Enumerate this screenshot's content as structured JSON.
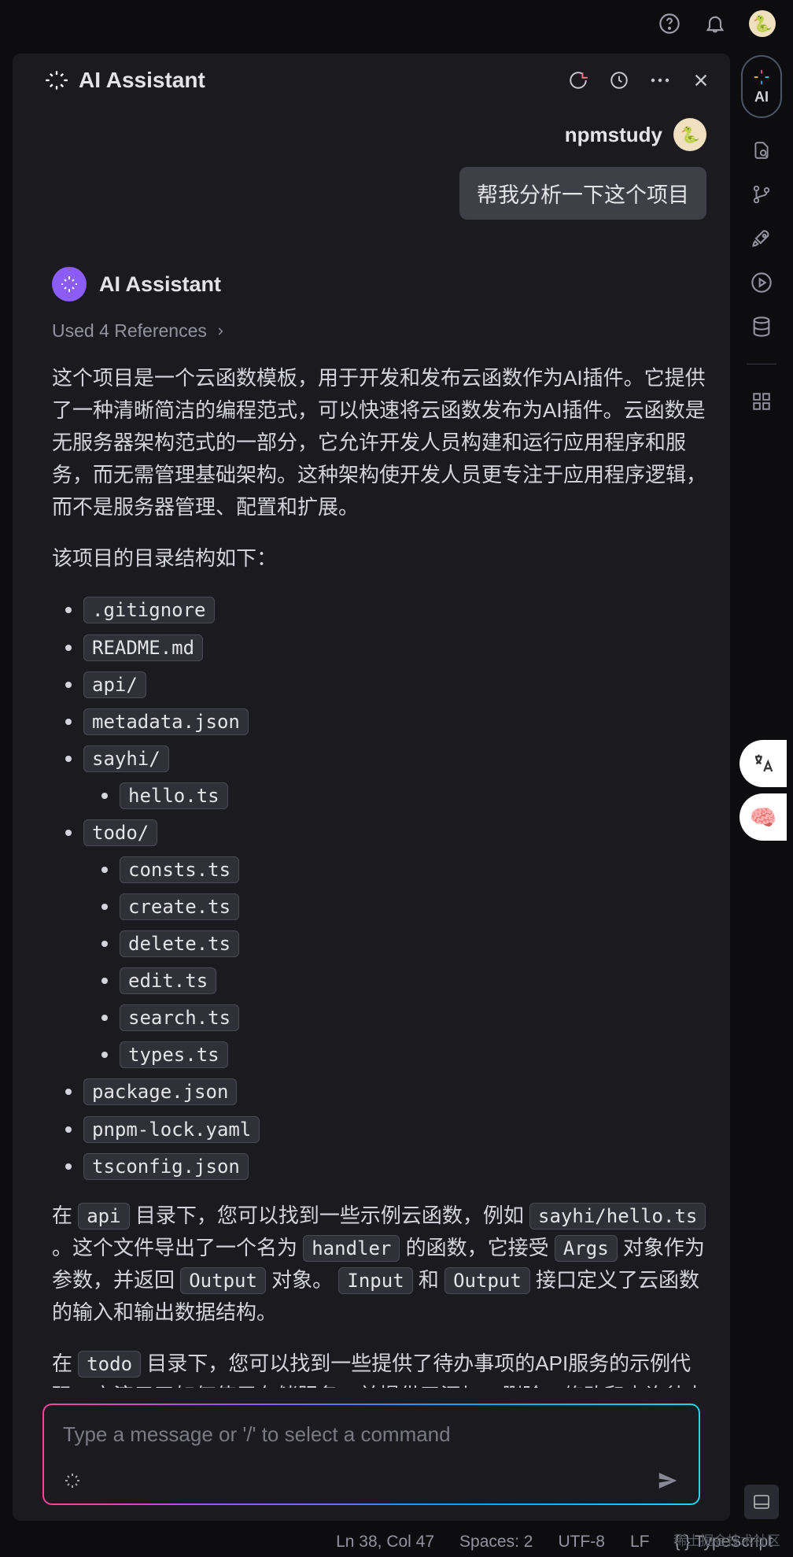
{
  "header": {
    "title": "AI Assistant"
  },
  "user_message": {
    "name": "npmstudy",
    "text": "帮我分析一下这个项目"
  },
  "assistant": {
    "name": "AI Assistant",
    "references": "Used 4 References",
    "para1": "这个项目是一个云函数模板，用于开发和发布云函数作为AI插件。它提供了一种清晰简洁的编程范式，可以快速将云函数发布为AI插件。云函数是无服务器架构范式的一部分，它允许开发人员构建和运行应用程序和服务，而无需管理基础架构。这种架构使开发人员更专注于应用程序逻辑，而不是服务器管理、配置和扩展。",
    "para2": "该项目的目录结构如下：",
    "files": [
      ".gitignore",
      "README.md",
      "api/",
      "metadata.json",
      "sayhi/",
      "todo/",
      "package.json",
      "pnpm-lock.yaml",
      "tsconfig.json"
    ],
    "sayhi_children": [
      "hello.ts"
    ],
    "todo_children": [
      "consts.ts",
      "create.ts",
      "delete.ts",
      "edit.ts",
      "search.ts",
      "types.ts"
    ],
    "para3_pre": "在 ",
    "para3_c1": "api",
    "para3_m1": " 目录下，您可以找到一些示例云函数，例如 ",
    "para3_c2": "sayhi/hello.ts",
    "para3_m2": " 。这个文件导出了一个名为 ",
    "para3_c3": "handler",
    "para3_m3": " 的函数，它接受 ",
    "para3_c4": "Args",
    "para3_m4": " 对象作为参数，并返回 ",
    "para3_c5": "Output",
    "para3_m5": " 对象。 ",
    "para3_c6": "Input",
    "para3_m6": " 和 ",
    "para3_c7": "Output",
    "para3_m7": " 接口定义了云函数的输入和输出数据结构。",
    "para4_pre": "在 ",
    "para4_c1": "todo",
    "para4_m1": " 目录下，您可以找到一些提供了待办事项的API服务的示例代码。它演示了如何使用存储服务，并提供了添加、删除、修改和查询待办事项的API功能。"
  },
  "input": {
    "placeholder": "Type a message or '/' to select a command"
  },
  "ai_badge": "AI",
  "status": {
    "position": "Ln 38, Col 47",
    "spaces": "Spaces: 2",
    "encoding": "UTF-8",
    "eol": "LF",
    "lang": "TypeScript"
  },
  "watermark": "稀土掘金技术社区"
}
